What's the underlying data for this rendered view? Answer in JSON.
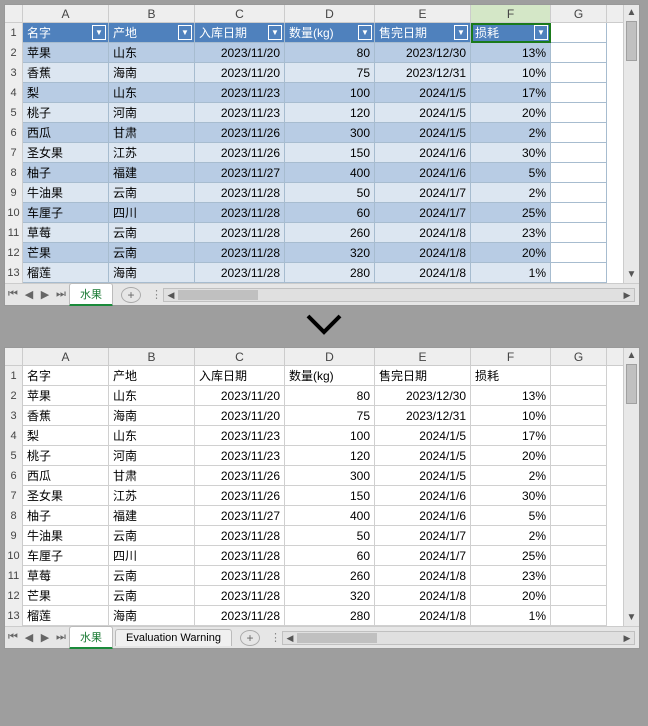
{
  "columns": [
    "A",
    "B",
    "C",
    "D",
    "E",
    "F",
    "G"
  ],
  "rownums": [
    1,
    2,
    3,
    4,
    5,
    6,
    7,
    8,
    9,
    10,
    11,
    12,
    13
  ],
  "headers": {
    "name": "名字",
    "origin": "产地",
    "indate": "入库日期",
    "qty": "数量(kg)",
    "selldate": "售完日期",
    "loss": "损耗"
  },
  "rows": [
    {
      "name": "苹果",
      "origin": "山东",
      "indate": "2023/11/20",
      "qty": "80",
      "selldate": "2023/12/30",
      "loss": "13%"
    },
    {
      "name": "香蕉",
      "origin": "海南",
      "indate": "2023/11/20",
      "qty": "75",
      "selldate": "2023/12/31",
      "loss": "10%"
    },
    {
      "name": "梨",
      "origin": "山东",
      "indate": "2023/11/23",
      "qty": "100",
      "selldate": "2024/1/5",
      "loss": "17%"
    },
    {
      "name": "桃子",
      "origin": "河南",
      "indate": "2023/11/23",
      "qty": "120",
      "selldate": "2024/1/5",
      "loss": "20%"
    },
    {
      "name": "西瓜",
      "origin": "甘肃",
      "indate": "2023/11/26",
      "qty": "300",
      "selldate": "2024/1/5",
      "loss": "2%"
    },
    {
      "name": "圣女果",
      "origin": "江苏",
      "indate": "2023/11/26",
      "qty": "150",
      "selldate": "2024/1/6",
      "loss": "30%"
    },
    {
      "name": "柚子",
      "origin": "福建",
      "indate": "2023/11/27",
      "qty": "400",
      "selldate": "2024/1/6",
      "loss": "5%"
    },
    {
      "name": "牛油果",
      "origin": "云南",
      "indate": "2023/11/28",
      "qty": "50",
      "selldate": "2024/1/7",
      "loss": "2%"
    },
    {
      "name": "车厘子",
      "origin": "四川",
      "indate": "2023/11/28",
      "qty": "60",
      "selldate": "2024/1/7",
      "loss": "25%"
    },
    {
      "name": "草莓",
      "origin": "云南",
      "indate": "2023/11/28",
      "qty": "260",
      "selldate": "2024/1/8",
      "loss": "23%"
    },
    {
      "name": "芒果",
      "origin": "云南",
      "indate": "2023/11/28",
      "qty": "320",
      "selldate": "2024/1/8",
      "loss": "20%"
    },
    {
      "name": "榴莲",
      "origin": "海南",
      "indate": "2023/11/28",
      "qty": "280",
      "selldate": "2024/1/8",
      "loss": "1%"
    }
  ],
  "selected_col_header": "F",
  "tabs_top": {
    "active": "水果",
    "extras": []
  },
  "tabs_bottom": {
    "active": "水果",
    "extras": [
      "Evaluation Warning"
    ]
  }
}
